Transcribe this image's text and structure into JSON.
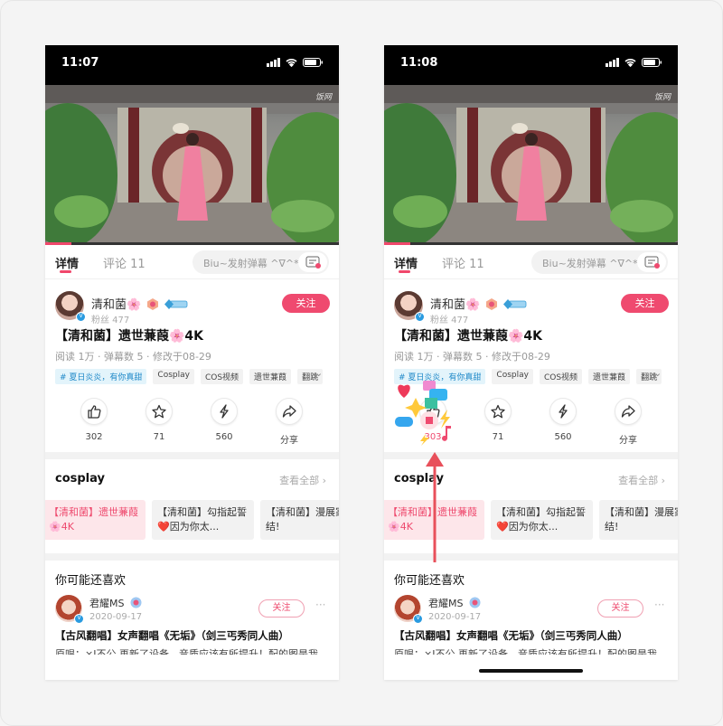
{
  "phones": [
    {
      "status": {
        "time": "11:07"
      },
      "video": {
        "watermark": "饭网"
      },
      "tabs": {
        "detail": "详情",
        "comments": "评论 11"
      },
      "danmaku": {
        "placeholder": "Biu~发射弹幕 ^∇^*"
      },
      "author": {
        "name": "清和菌🌸",
        "fans": "粉丝 477",
        "follow": "关注"
      },
      "post": {
        "title": "【清和菌】遗世蒹葭🌸4K",
        "meta": "阅读 1万 · 弹幕数 5 · 修改于08-29"
      },
      "tags": [
        "# 夏日炎炎，有你真甜",
        "Cosplay",
        "COS视频",
        "遗世蒹葭",
        "翻跳"
      ],
      "actions": [
        {
          "icon": "thumbs-up-icon",
          "label": "302"
        },
        {
          "icon": "star-icon",
          "label": "71"
        },
        {
          "icon": "lightning-icon",
          "label": "560"
        },
        {
          "icon": "share-icon",
          "label": "分享"
        }
      ],
      "collection": {
        "title": "cosplay",
        "view_all": "查看全部 ›",
        "cards": [
          "【清和菌】遗世蒹葭🌸4K",
          "【清和菌】勾指起誓❤️因为你太...",
          "【清和菌】漫展家集结!"
        ]
      },
      "recommend": {
        "title": "你可能还喜欢",
        "user": "君耀MS",
        "date": "2020-09-17",
        "follow": "关注",
        "more": "···",
        "post_title": "【古风翻唱】女声翻唱《无垢》（剑三丐秀同人曲）",
        "post_desc": "原唱：×I不公 再新了设备，音质应该有所提升！配的图是我"
      }
    },
    {
      "status": {
        "time": "11:08"
      },
      "video": {
        "watermark": "饭网"
      },
      "tabs": {
        "detail": "详情",
        "comments": "评论 11"
      },
      "danmaku": {
        "placeholder": "Biu~发射弹幕 ^∇^*"
      },
      "author": {
        "name": "清和菌🌸",
        "fans": "粉丝 477",
        "follow": "关注"
      },
      "post": {
        "title": "【清和菌】遗世蒹葭🌸4K",
        "meta": "阅读 1万 · 弹幕数 5 · 修改于08-29"
      },
      "tags": [
        "# 夏日炎炎，有你真甜",
        "Cosplay",
        "COS视频",
        "遗世蒹葭",
        "翻跳"
      ],
      "actions": [
        {
          "icon": "thumbs-up-icon",
          "label": "303"
        },
        {
          "icon": "star-icon",
          "label": "71"
        },
        {
          "icon": "lightning-icon",
          "label": "560"
        },
        {
          "icon": "share-icon",
          "label": "分享"
        }
      ],
      "collection": {
        "title": "cosplay",
        "view_all": "查看全部 ›",
        "cards": [
          "【清和菌】遗世蒹葭🌸4K",
          "【清和菌】勾指起誓❤️因为你太...",
          "【清和菌】漫展家集结!"
        ]
      },
      "recommend": {
        "title": "你可能还喜欢",
        "user": "君耀MS",
        "date": "2020-09-17",
        "follow": "关注",
        "more": "···",
        "post_title": "【古风翻唱】女声翻唱《无垢》（剑三丐秀同人曲）",
        "post_desc": "原唱：×I不公 再新了设备，音质应该有所提升！配的图是我"
      }
    }
  ],
  "colors": {
    "accent": "#ef4a6f",
    "arrow": "#e8505b",
    "topic_tag": "#1e88c8"
  }
}
